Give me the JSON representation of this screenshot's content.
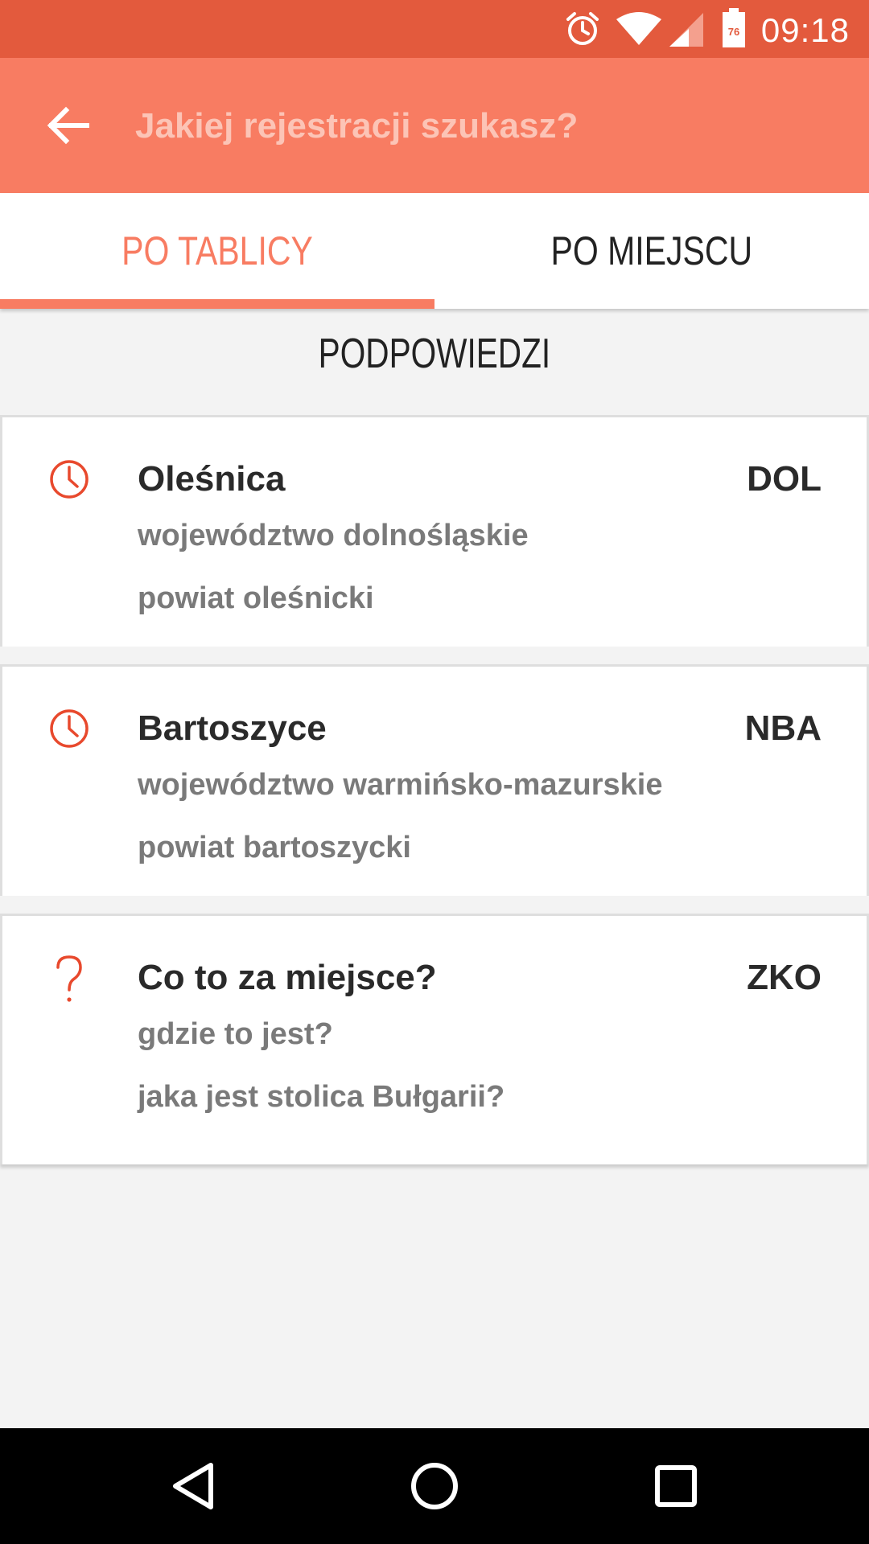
{
  "status_bar": {
    "time": "09:18",
    "battery_level": "76",
    "icons": [
      "alarm-icon",
      "wifi-icon",
      "signal-icon",
      "battery-icon"
    ]
  },
  "app_bar": {
    "back_icon": "arrow-left-icon",
    "search_placeholder": "Jakiej rejestracji szukasz?",
    "search_value": ""
  },
  "tabs": [
    {
      "label": "PO TABLICY",
      "active": true
    },
    {
      "label": "PO MIEJSCU",
      "active": false
    }
  ],
  "section_header": "PODPOWIEDZI",
  "suggestions": [
    {
      "icon": "clock-icon",
      "title": "Oleśnica",
      "code": "DOL",
      "line1": "województwo dolnośląskie",
      "line2": "powiat oleśnicki"
    },
    {
      "icon": "clock-icon",
      "title": "Bartoszyce",
      "code": "NBA",
      "line1": "województwo warmińsko-mazurskie",
      "line2": "powiat bartoszycki"
    },
    {
      "icon": "question-icon",
      "title": "Co to za miejsce?",
      "code": "ZKO",
      "line1": "gdzie to jest?",
      "line2": "jaka jest stolica Bułgarii?"
    }
  ],
  "nav_bar": {
    "buttons": [
      "back-triangle-icon",
      "home-circle-icon",
      "recents-square-icon"
    ]
  },
  "colors": {
    "status_bar": "#e35a3d",
    "app_bar": "#f87c62",
    "accent": "#f87c62",
    "icon_red": "#e8492d",
    "background": "#f3f3f3"
  }
}
